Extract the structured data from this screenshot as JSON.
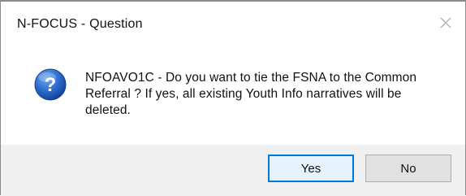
{
  "window": {
    "title": "N-FOCUS - Question"
  },
  "icons": {
    "close": "close-icon",
    "question": "question-icon"
  },
  "colors": {
    "question_icon_blue": "#1f5fbf",
    "default_button_border": "#0078d7",
    "footer_bg": "#f0f0f0"
  },
  "message": {
    "text": "NFOAVO1C - Do you want to tie the FSNA to the Common Referral ? If yes, all existing Youth Info narratives will be deleted."
  },
  "buttons": {
    "yes_label": "Yes",
    "no_label": "No"
  }
}
